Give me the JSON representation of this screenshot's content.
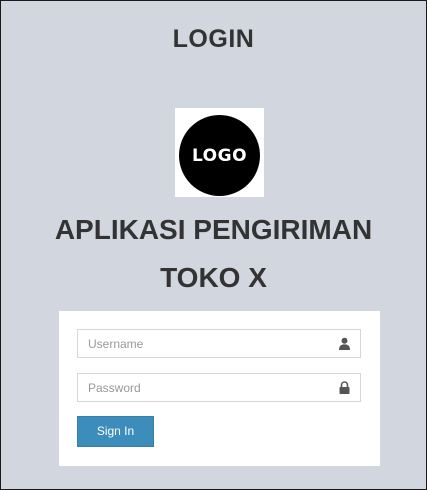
{
  "header": {
    "title": "LOGIN"
  },
  "logo": {
    "text": "LOGO"
  },
  "app": {
    "title_line1": "APLIKASI PENGIRIMAN",
    "title_line2": "TOKO X"
  },
  "form": {
    "username_placeholder": "Username",
    "password_placeholder": "Password",
    "username_value": "",
    "password_value": "",
    "username_icon": "user-icon",
    "password_icon": "lock-icon",
    "signin_label": "Sign In"
  },
  "colors": {
    "page_background": "#d2d6de",
    "box_background": "#ffffff",
    "primary_button": "#3c8dbc",
    "title_text": "#333333"
  }
}
